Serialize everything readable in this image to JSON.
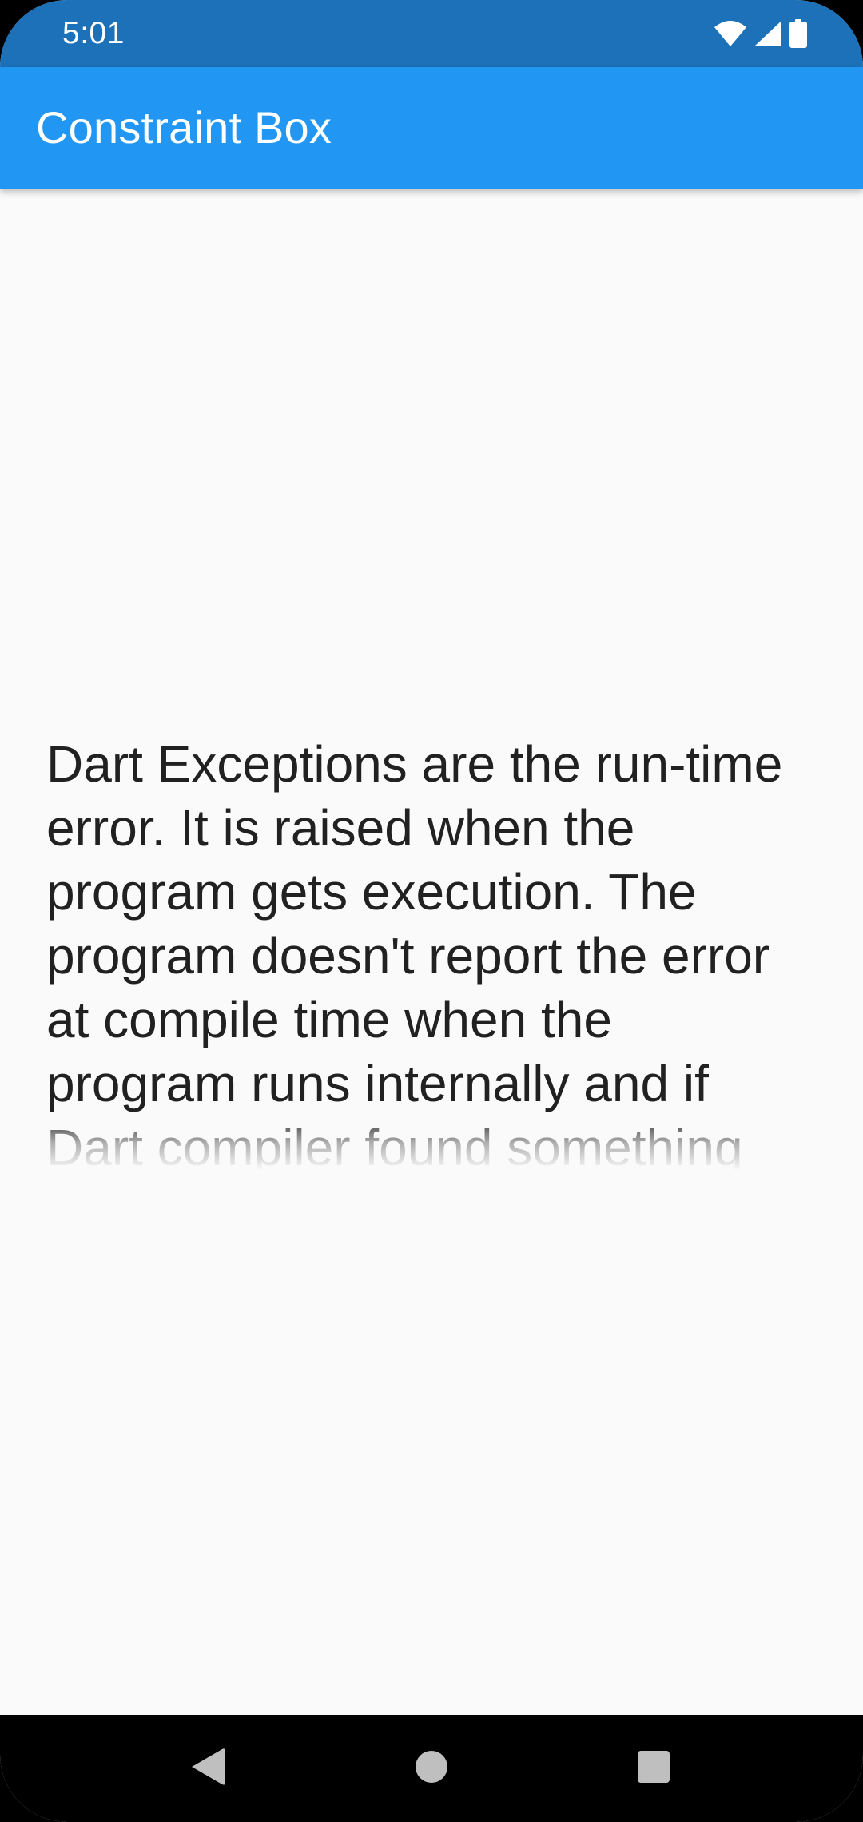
{
  "status_bar": {
    "time": "5:01",
    "icons": [
      "wifi-icon",
      "cellular-signal-icon",
      "battery-icon"
    ],
    "background": "#1c71b8"
  },
  "app_bar": {
    "title": "Constraint Box",
    "background": "#2196f3"
  },
  "main": {
    "body_text": "Dart Exceptions are the run-time error. It is raised when the program gets execution. The program doesn't report the error at compile time when the program runs internally and if Dart compiler found something",
    "text_color": "#212121",
    "background": "#fafafa"
  },
  "nav_bar": {
    "buttons": [
      "back-icon",
      "home-icon",
      "recents-icon"
    ],
    "background": "#000000"
  }
}
